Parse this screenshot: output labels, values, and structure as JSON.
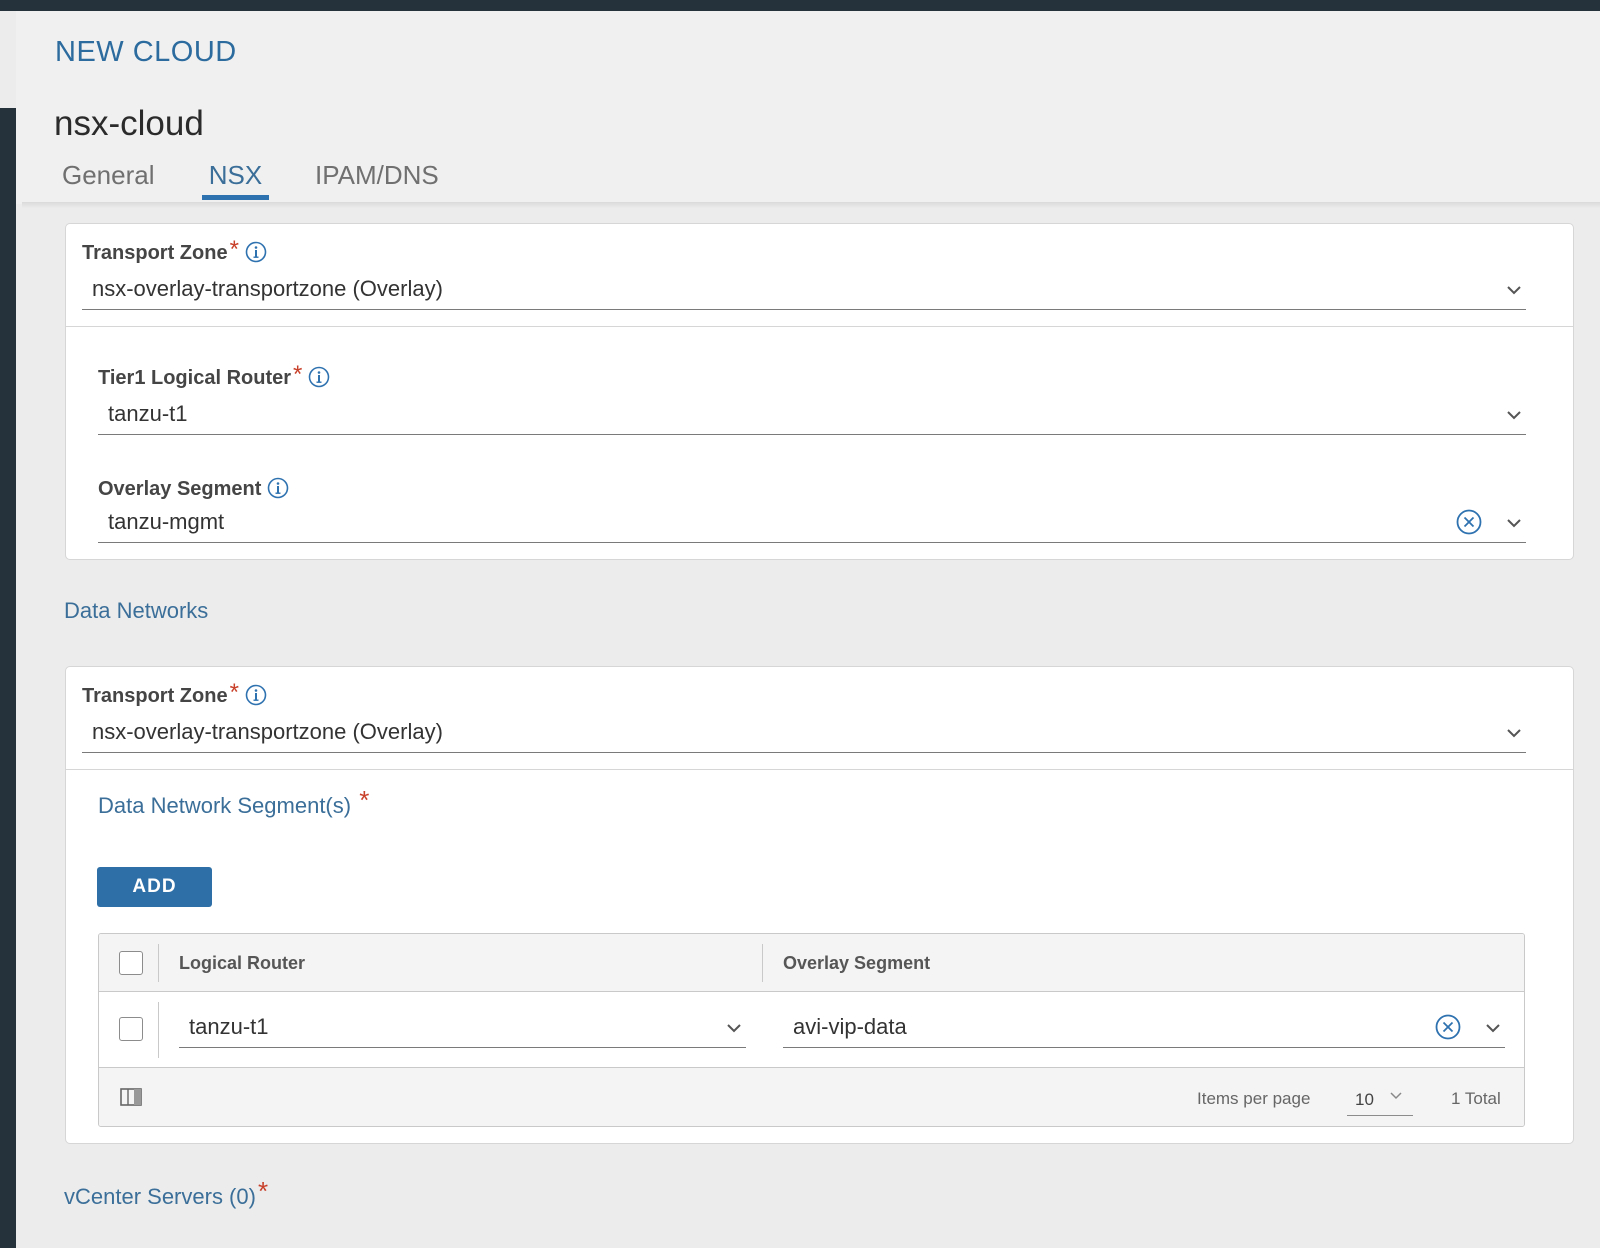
{
  "modal": {
    "title": "NEW CLOUD",
    "cloud_name": "nsx-cloud"
  },
  "tabs": [
    {
      "label": "General",
      "active": false
    },
    {
      "label": "NSX",
      "active": true
    },
    {
      "label": "IPAM/DNS",
      "active": false
    }
  ],
  "management_network": {
    "transport_zone": {
      "label": "Transport Zone",
      "required": "*",
      "value": "nsx-overlay-transportzone (Overlay)"
    },
    "tier1_router": {
      "label": "Tier1 Logical Router",
      "required": "*",
      "value": "tanzu-t1"
    },
    "overlay_segment": {
      "label": "Overlay Segment",
      "value": "tanzu-mgmt"
    }
  },
  "data_networks": {
    "title": "Data Networks",
    "transport_zone": {
      "label": "Transport Zone",
      "required": "*",
      "value": "nsx-overlay-transportzone (Overlay)"
    },
    "segments": {
      "title": "Data Network Segment(s)",
      "required": "*",
      "add_label": "ADD",
      "columns": [
        "Logical Router",
        "Overlay Segment"
      ],
      "rows": [
        {
          "logical_router": "tanzu-t1",
          "overlay_segment": "avi-vip-data"
        }
      ],
      "footer": {
        "items_per_page_label": "Items per page",
        "page_size": "10",
        "total": "1 Total"
      }
    }
  },
  "vcenter": {
    "title": "vCenter Servers (0)",
    "required": "*"
  },
  "colors": {
    "accent": "#2f6fa7",
    "required": "#c8402a",
    "dark_chrome": "#25313b"
  }
}
